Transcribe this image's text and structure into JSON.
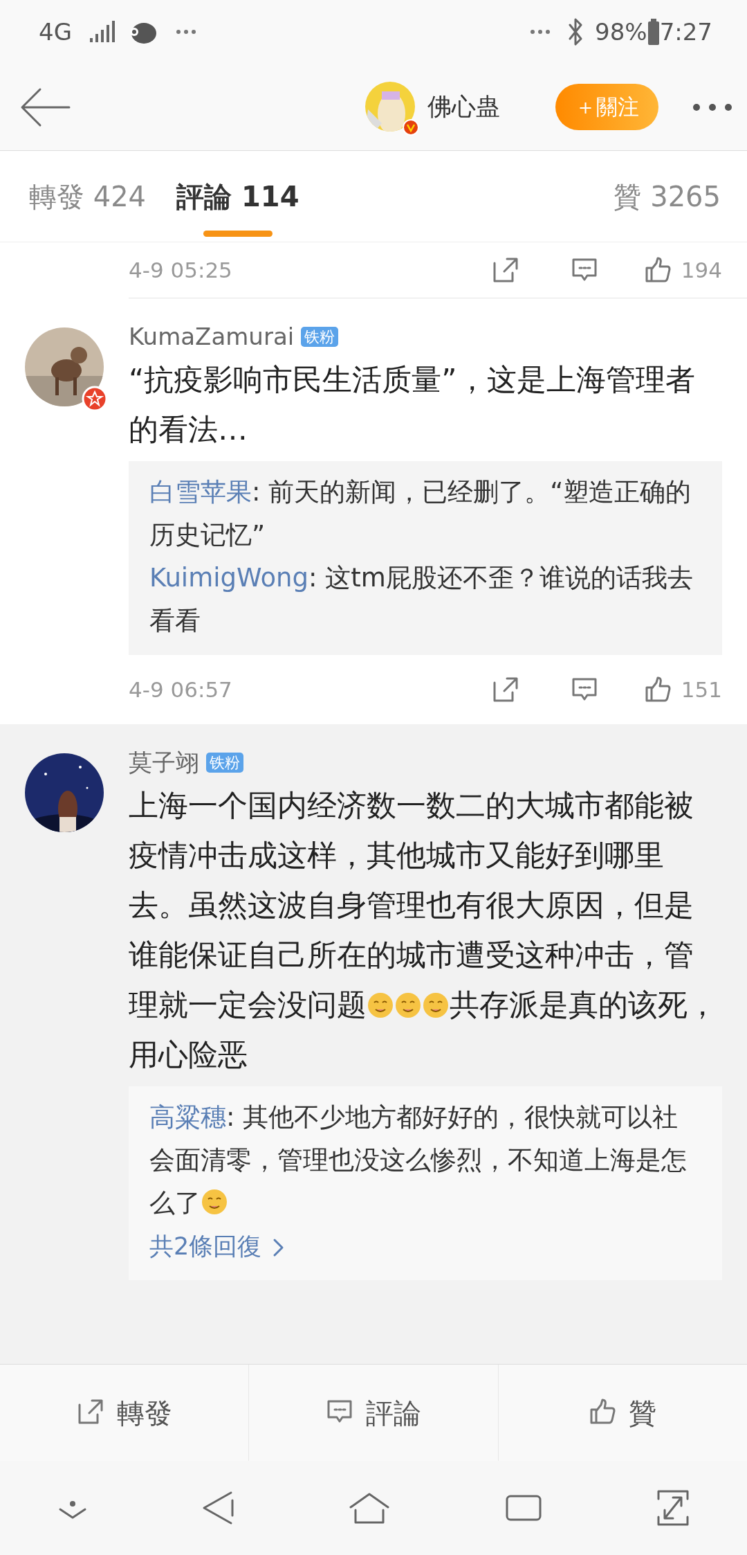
{
  "status_bar": {
    "network": "4G",
    "battery": "98%",
    "time": "7:27"
  },
  "header": {
    "title": "佛心蛊",
    "follow_button": "＋關注"
  },
  "tabs": [
    {
      "label": "轉發 424",
      "selected": false
    },
    {
      "label": "評論 114",
      "selected": true
    },
    {
      "label": "贊 3265",
      "selected": false
    }
  ],
  "comments": [
    {
      "kind": "tail",
      "time": "4-9 05:25",
      "likes": "194",
      "highlighted": false
    },
    {
      "kind": "full",
      "user": "KumaZamurai",
      "badge": "铁粉",
      "highlighted": false,
      "body": [
        {
          "kind": "text",
          "text": "“抗疫影响市民生活质量”，这是上海管理者的看法…"
        }
      ],
      "replies": [
        {
          "user": "白雪苹果",
          "body": [
            {
              "kind": "text",
              "text": ": 前天的新闻，已经删了。“塑造正确的历史记忆”"
            }
          ]
        },
        {
          "user": "KuimigWong",
          "body": [
            {
              "kind": "text",
              "text": ": 这tm屁股还不歪？谁说的话我去看看"
            }
          ]
        }
      ],
      "time": "4-9 06:57",
      "likes": "151"
    },
    {
      "kind": "full",
      "user": "莫子翊",
      "badge": "铁粉",
      "highlighted": true,
      "body": [
        {
          "kind": "text",
          "text": "上海一个国内经济数一数二的大城市都能被疫情冲击成这样，其他城市又能好到哪里去。虽然这波自身管理也有很大原因，但是谁能保证自己所在的城市遭受这种冲击，管理就一定会没问题"
        },
        {
          "kind": "emoji"
        },
        {
          "kind": "emoji"
        },
        {
          "kind": "emoji"
        },
        {
          "kind": "text",
          "text": "共存派是真的该死，用心险恶"
        }
      ],
      "replies": [
        {
          "user": "高粱穗",
          "body": [
            {
              "kind": "text",
              "text": ": 其他不少地方都好好的，很快就可以社会面清零，管理也没这么惨烈，不知道上海是怎么了"
            },
            {
              "kind": "emoji"
            }
          ]
        }
      ],
      "more_replies": "共2條回復"
    }
  ],
  "action_bar": [
    {
      "kind": "share",
      "label": "轉發"
    },
    {
      "kind": "comment",
      "label": "評論"
    },
    {
      "kind": "like",
      "label": "贊"
    }
  ]
}
